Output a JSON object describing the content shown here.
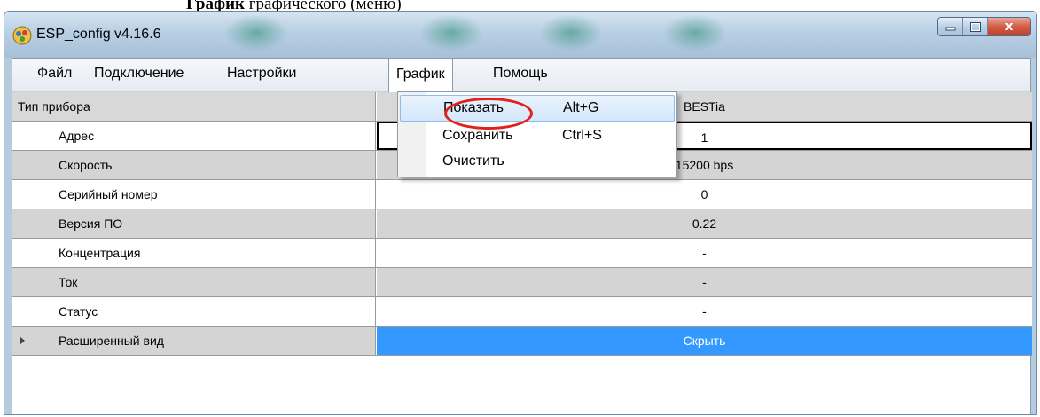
{
  "doc_caption": {
    "bold": "График",
    "normal": " графического (меню)"
  },
  "window": {
    "title": "ESP_config v4.16.6",
    "app_icon": "gear-app-icon",
    "buttons": {
      "minimize": "minimize-icon",
      "maximize": "maximize-icon",
      "close": "x"
    }
  },
  "menu": {
    "items": [
      "Файл",
      "Подключение",
      "Настройки",
      "График",
      "Помощь"
    ],
    "open_index": 3
  },
  "dropdown": {
    "items": [
      {
        "label": "Показать",
        "shortcut": "Alt+G"
      },
      {
        "label": "Сохранить",
        "shortcut": "Ctrl+S"
      },
      {
        "label": "Очистить",
        "shortcut": ""
      }
    ],
    "highlight_color": "#d4e7fa",
    "annotation_color": "#e0221a"
  },
  "grid": {
    "rows": [
      {
        "label": "Тип прибора",
        "value": "BESTia"
      },
      {
        "label": "Адрес",
        "value": "1"
      },
      {
        "label": "Скорость",
        "value": "15200 bps"
      },
      {
        "label": "Серийный номер",
        "value": "0"
      },
      {
        "label": "Версия ПО",
        "value": "0.22"
      },
      {
        "label": "Концентрация",
        "value": "-"
      },
      {
        "label": "Ток",
        "value": "-"
      },
      {
        "label": "Статус",
        "value": "-"
      },
      {
        "label": "Расширенный вид",
        "value": "Скрыть"
      }
    ],
    "accent_color": "#3399ff"
  }
}
